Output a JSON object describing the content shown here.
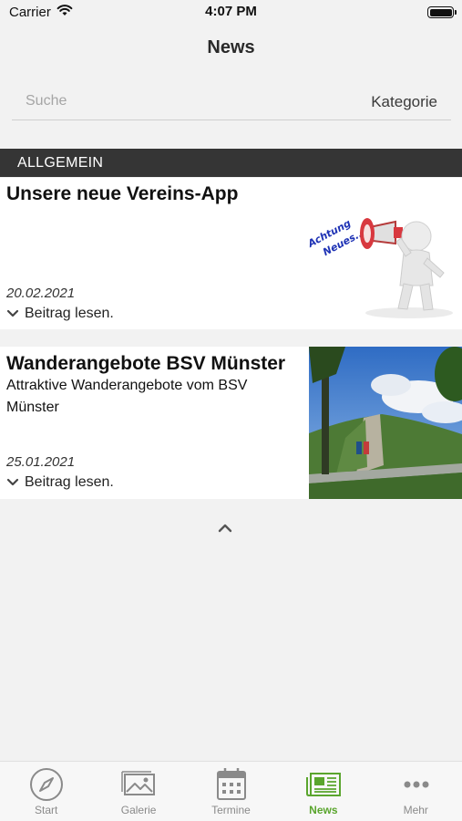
{
  "status_bar": {
    "carrier": "Carrier",
    "time": "4:07 PM"
  },
  "nav": {
    "title": "News"
  },
  "search": {
    "placeholder": "Suche",
    "category_label": "Kategorie"
  },
  "section": {
    "title": "ALLGEMEIN"
  },
  "posts": [
    {
      "title": "Unsere neue Vereins-App",
      "text": "",
      "date": "20.02.2021",
      "read_more": "Beitrag lesen.",
      "image_caption": "Achtung Neues...."
    },
    {
      "title": "Wanderangebote BSV Münster",
      "text": "Attraktive Wanderangebote vom BSV Münster",
      "date": "25.01.2021",
      "read_more": "Beitrag lesen."
    }
  ],
  "tab_bar": {
    "active": "News",
    "tabs": [
      {
        "label": "Start",
        "icon": "compass-icon"
      },
      {
        "label": "Galerie",
        "icon": "gallery-icon"
      },
      {
        "label": "Termine",
        "icon": "calendar-icon"
      },
      {
        "label": "News",
        "icon": "newspaper-icon"
      },
      {
        "label": "Mehr",
        "icon": "more-dots-icon"
      }
    ]
  },
  "colors": {
    "accent": "#5aa52d",
    "section_header": "#353535",
    "inactive_tab": "#8a8a8a"
  }
}
